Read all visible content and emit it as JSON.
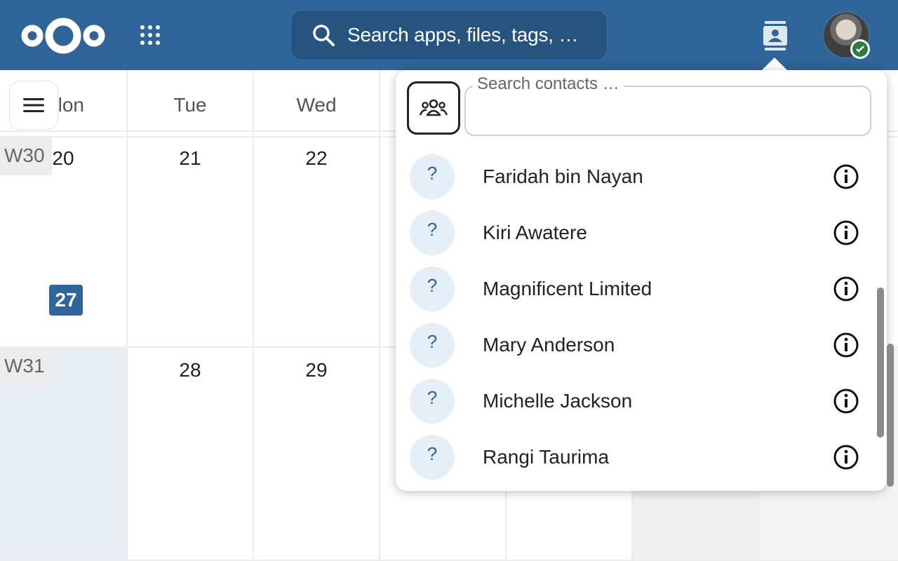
{
  "header": {
    "search_placeholder": "Search apps, files, tags, …",
    "icons": {
      "logo": "nextcloud-logo",
      "apps": "apps-grid-icon",
      "search": "search-icon",
      "contacts": "contacts-icon",
      "status": "online-status-icon"
    },
    "colors": {
      "background": "#2f6498",
      "search_bg": "#26547f"
    }
  },
  "calendar": {
    "day_headers": [
      "lon",
      "Tue",
      "Wed"
    ],
    "weeks": [
      {
        "label": "W30",
        "dates": [
          "20",
          "21",
          "22"
        ]
      },
      {
        "label": "W31",
        "dates": [
          "27",
          "28",
          "29"
        ]
      }
    ],
    "today": "27",
    "today_color": "#2f6498"
  },
  "contacts_menu": {
    "search_label": "Search contacts …",
    "search_value": "",
    "contacts": [
      {
        "name": "Faridah bin Nayan",
        "avatar": "?"
      },
      {
        "name": "Kiri Awatere",
        "avatar": "?"
      },
      {
        "name": "Magnificent Limited",
        "avatar": "?"
      },
      {
        "name": "Mary Anderson",
        "avatar": "?"
      },
      {
        "name": "Michelle Jackson",
        "avatar": "?"
      },
      {
        "name": "Rangi Taurima",
        "avatar": "?"
      }
    ]
  }
}
